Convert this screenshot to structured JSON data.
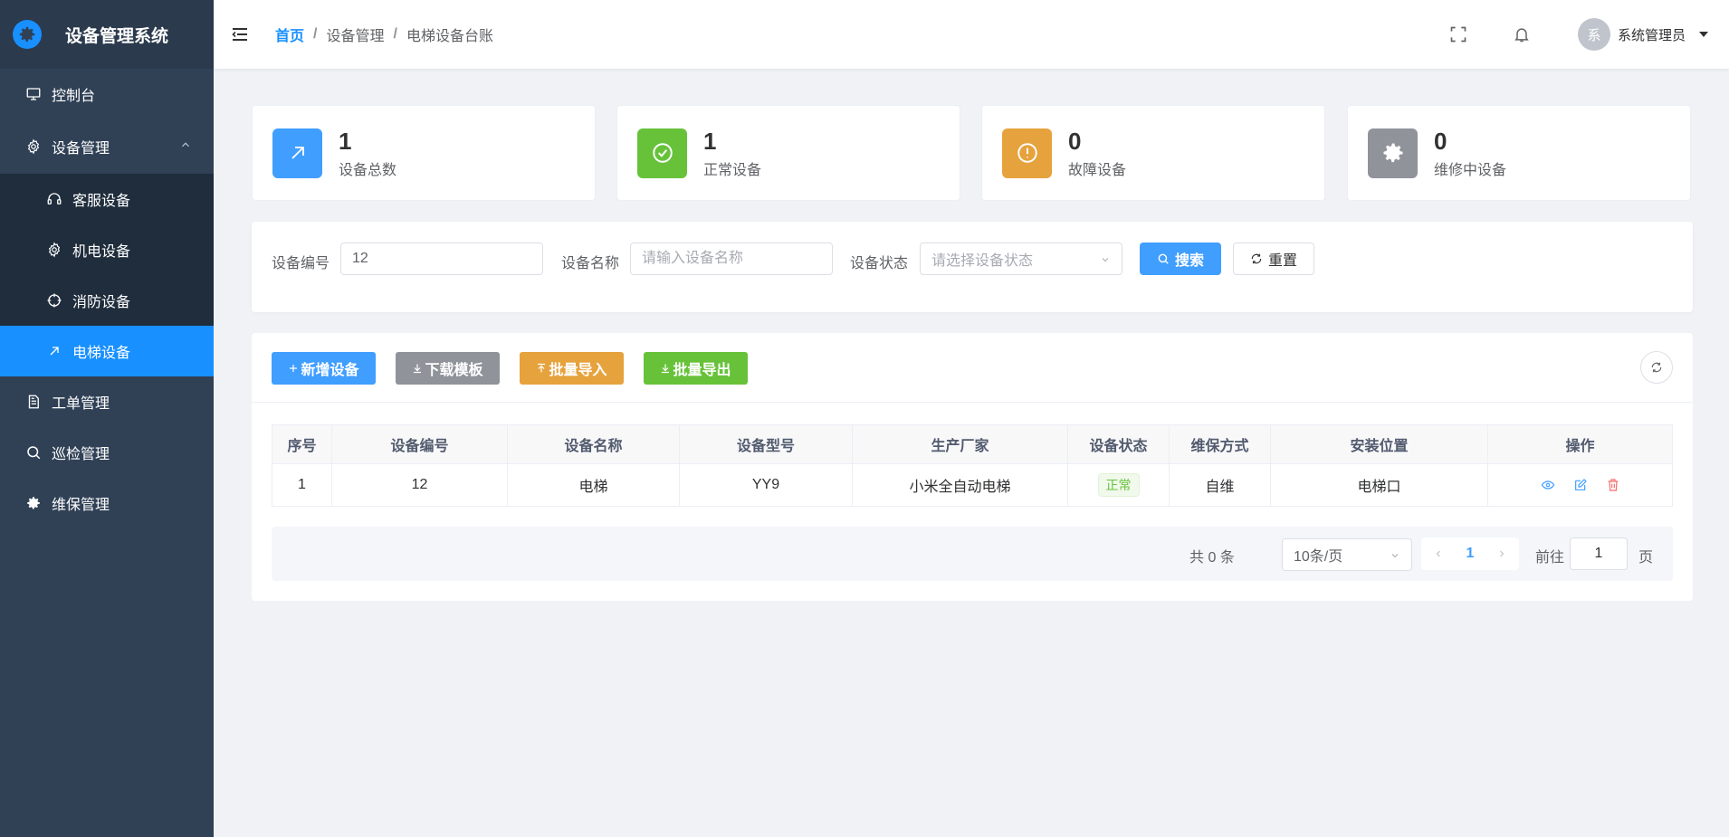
{
  "app": {
    "title": "设备管理系统"
  },
  "sidebar": {
    "items": [
      {
        "label": "控制台",
        "icon": "monitor-icon"
      },
      {
        "label": "设备管理",
        "icon": "gear-icon"
      },
      {
        "label": "客服设备",
        "icon": "headset-icon"
      },
      {
        "label": "机电设备",
        "icon": "gear-icon"
      },
      {
        "label": "消防设备",
        "icon": "crosshair-icon"
      },
      {
        "label": "电梯设备",
        "icon": "arrow-up-right-icon"
      },
      {
        "label": "工单管理",
        "icon": "document-icon"
      },
      {
        "label": "巡检管理",
        "icon": "search-icon"
      },
      {
        "label": "维保管理",
        "icon": "gear-filled-icon"
      }
    ]
  },
  "header": {
    "breadcrumb": [
      "首页",
      "设备管理",
      "电梯设备台账"
    ],
    "separator": "/",
    "user": {
      "avatar_text": "系",
      "name": "系统管理员"
    }
  },
  "stats": [
    {
      "value": "1",
      "label": "设备总数",
      "color": "#409eff",
      "icon": "arrow-up-right-icon"
    },
    {
      "value": "1",
      "label": "正常设备",
      "color": "#67c23a",
      "icon": "check-circle-icon"
    },
    {
      "value": "0",
      "label": "故障设备",
      "color": "#e6a23c",
      "icon": "warning-circle-icon"
    },
    {
      "value": "0",
      "label": "维修中设备",
      "color": "#909399",
      "icon": "gear-filled-icon"
    }
  ],
  "search": {
    "code_label": "设备编号",
    "code_value": "12",
    "name_label": "设备名称",
    "name_placeholder": "请输入设备名称",
    "status_label": "设备状态",
    "status_placeholder": "请选择设备状态",
    "search_button": "搜索",
    "reset_button": "重置"
  },
  "toolbar": {
    "add": "新增设备",
    "download": "下载模板",
    "import": "批量导入",
    "export": "批量导出",
    "colors": {
      "add": "#409eff",
      "download": "#909399",
      "import": "#e6a23c",
      "export": "#67c23a"
    }
  },
  "table": {
    "columns": [
      "序号",
      "设备编号",
      "设备名称",
      "设备型号",
      "生产厂家",
      "设备状态",
      "维保方式",
      "安装位置",
      "操作"
    ],
    "rows": [
      {
        "index": "1",
        "code": "12",
        "name": "电梯",
        "model": "YY9",
        "maker": "小米全自动电梯",
        "status": "正常",
        "maintenance": "自维",
        "location": "电梯口"
      }
    ]
  },
  "pagination": {
    "total": "共 0 条",
    "page_size": "10条/页",
    "current": "1",
    "goto_label": "前往",
    "goto_value": "1",
    "page_suffix": "页"
  }
}
